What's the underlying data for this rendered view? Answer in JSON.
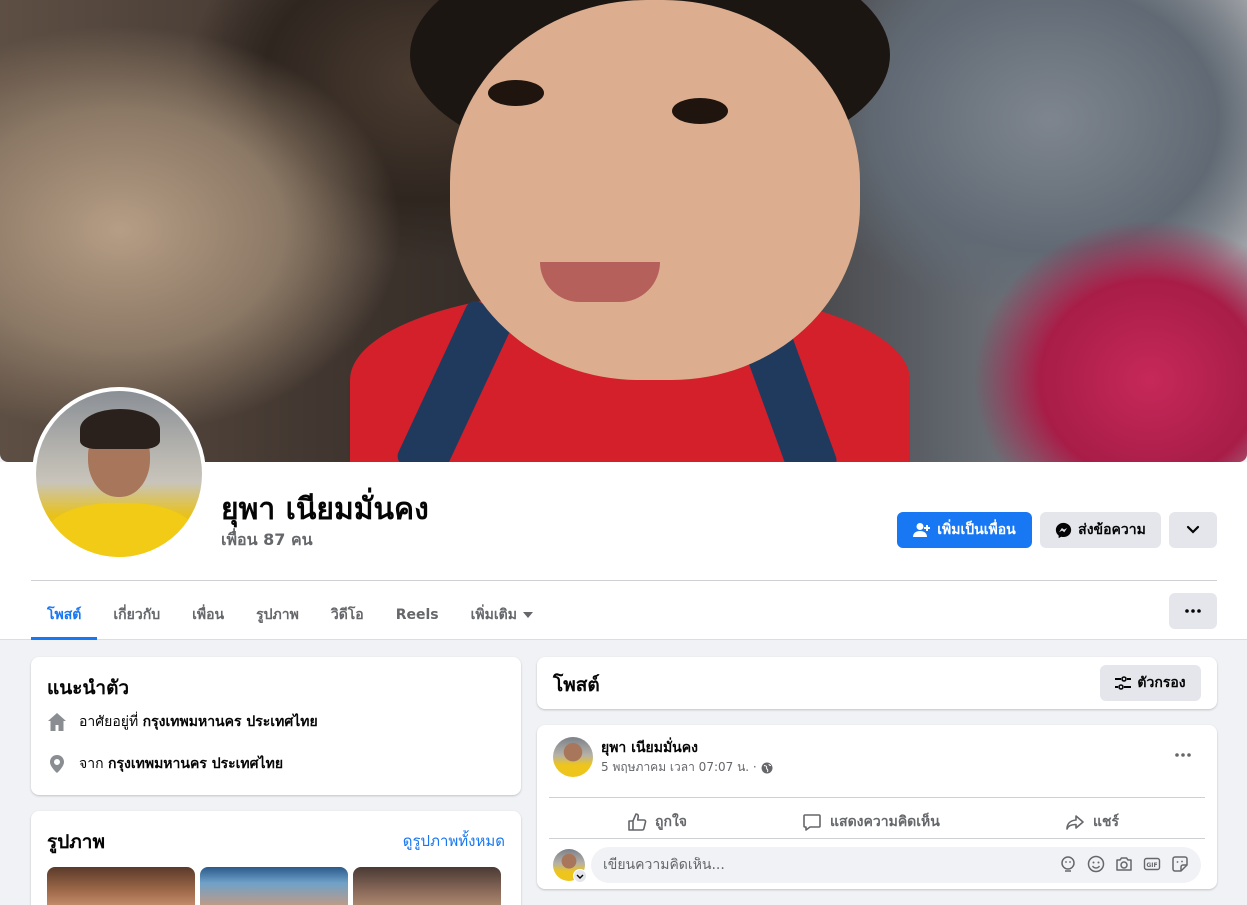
{
  "profile": {
    "name": "ยุพา เนียมมั่นคง",
    "friends": "เพื่อน 87 คน"
  },
  "actions": {
    "add_friend": "เพิ่มเป็นเพื่อน",
    "message": "ส่งข้อความ"
  },
  "tabs": [
    {
      "label": "โพสต์"
    },
    {
      "label": "เกี่ยวกับ"
    },
    {
      "label": "เพื่อน"
    },
    {
      "label": "รูปภาพ"
    },
    {
      "label": "วิดีโอ"
    },
    {
      "label": "Reels"
    },
    {
      "label": "เพิ่มเติม"
    }
  ],
  "intro": {
    "title": "แนะนำตัว",
    "lives_in_prefix": "อาศัยอยู่ที่",
    "lives_in": "กรุงเทพมหานคร ประเทศไทย",
    "from_prefix": "จาก",
    "from": "กรุงเทพมหานคร ประเทศไทย"
  },
  "photos": {
    "title": "รูปภาพ",
    "see_all": "ดูรูปภาพทั้งหมด"
  },
  "posts_header": {
    "title": "โพสต์",
    "filter": "ตัวกรอง"
  },
  "post": {
    "author": "ยุพา เนียมมั่นคง",
    "time": "5 พฤษภาคม เวลา 07:07 น. ·",
    "like": "ถูกใจ",
    "comment": "แสดงความคิดเห็น",
    "share": "แชร์",
    "comment_placeholder": "เขียนความคิดเห็น..."
  },
  "colors": {
    "accent": "#1877f2",
    "background": "#f0f2f5",
    "secondary_text": "#65676b"
  }
}
